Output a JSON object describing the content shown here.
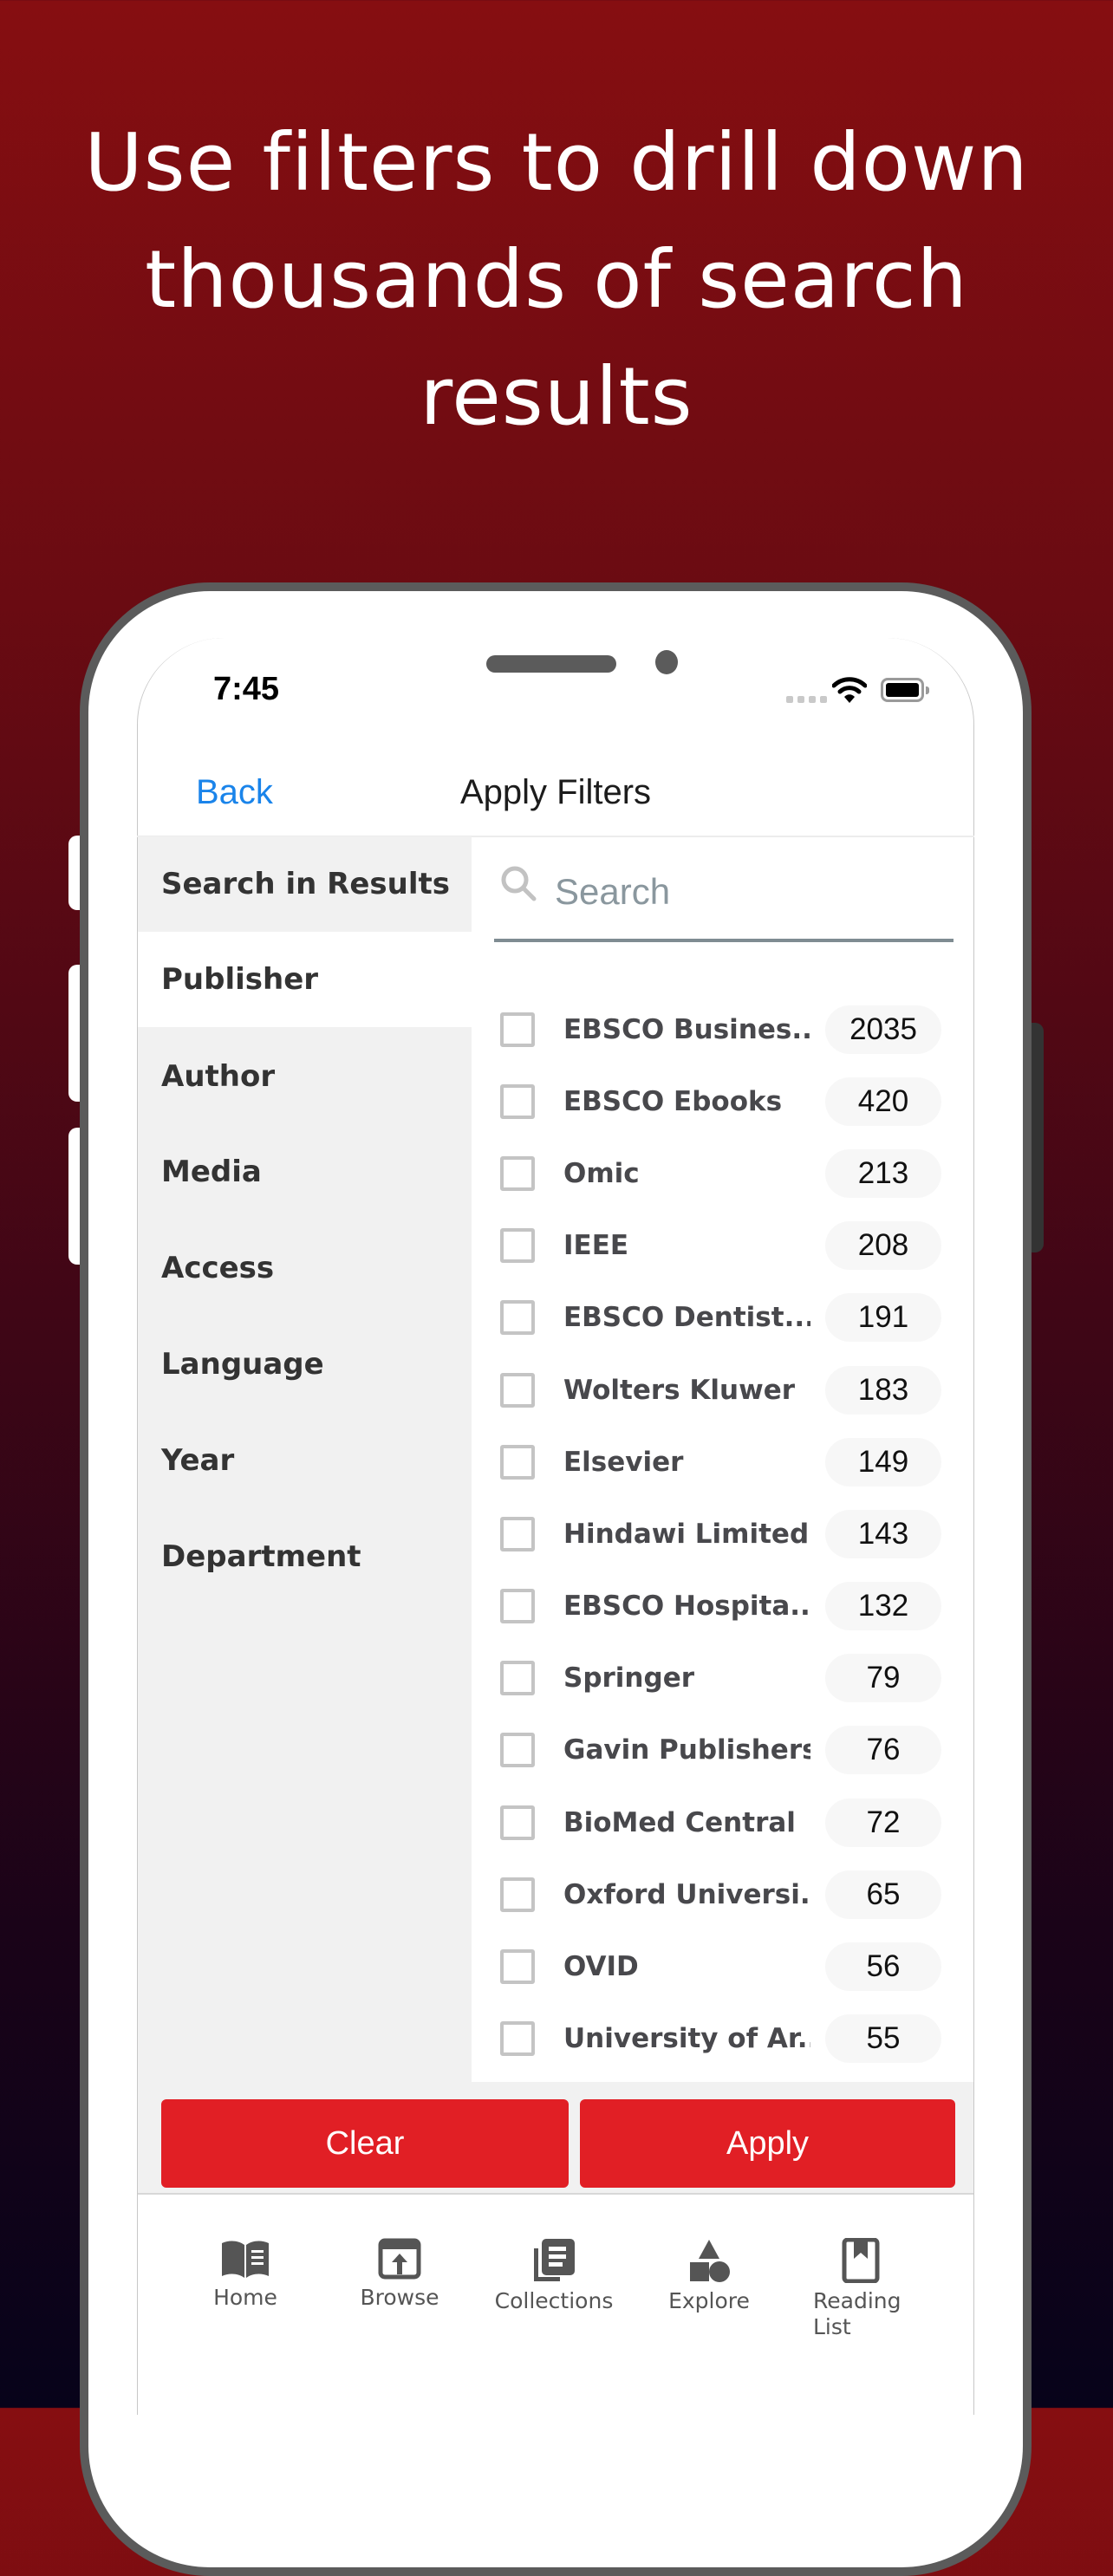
{
  "headline": {
    "line1": "Use filters to drill down",
    "line2": "thousands of search",
    "line3": "results"
  },
  "status_bar": {
    "time": "7:45",
    "wifi_icon": "wifi-icon",
    "battery_icon": "battery-icon"
  },
  "nav": {
    "back_label": "Back",
    "title": "Apply Filters"
  },
  "sidebar": {
    "items": [
      {
        "label": "Search in Results",
        "active": false
      },
      {
        "label": "Publisher",
        "active": true
      },
      {
        "label": "Author",
        "active": false
      },
      {
        "label": "Media",
        "active": false
      },
      {
        "label": "Access",
        "active": false
      },
      {
        "label": "Language",
        "active": false
      },
      {
        "label": "Year",
        "active": false
      },
      {
        "label": "Department",
        "active": false
      }
    ]
  },
  "search": {
    "placeholder": "Search",
    "value": ""
  },
  "publishers": [
    {
      "name": "EBSCO Busines...",
      "count": "2035",
      "checked": false
    },
    {
      "name": "EBSCO Ebooks",
      "count": "420",
      "checked": false
    },
    {
      "name": "Omic",
      "count": "213",
      "checked": false
    },
    {
      "name": "IEEE",
      "count": "208",
      "checked": false
    },
    {
      "name": "EBSCO Dentist...",
      "count": "191",
      "checked": false
    },
    {
      "name": "Wolters Kluwer",
      "count": "183",
      "checked": false
    },
    {
      "name": "Elsevier",
      "count": "149",
      "checked": false
    },
    {
      "name": "Hindawi Limited",
      "count": "143",
      "checked": false
    },
    {
      "name": "EBSCO Hospita...",
      "count": "132",
      "checked": false
    },
    {
      "name": "Springer",
      "count": "79",
      "checked": false
    },
    {
      "name": "Gavin Publishers",
      "count": "76",
      "checked": false
    },
    {
      "name": "BioMed Central",
      "count": "72",
      "checked": false
    },
    {
      "name": "Oxford Universi...",
      "count": "65",
      "checked": false
    },
    {
      "name": "OVID",
      "count": "56",
      "checked": false
    },
    {
      "name": "University of Ar...",
      "count": "55",
      "checked": false
    }
  ],
  "actions": {
    "clear_label": "Clear",
    "apply_label": "Apply"
  },
  "tabbar": {
    "items": [
      {
        "label": "Home",
        "icon": "open-book-icon"
      },
      {
        "label": "Browse",
        "icon": "browse-upload-icon"
      },
      {
        "label": "Collections",
        "icon": "collections-stack-icon"
      },
      {
        "label": "Explore",
        "icon": "shapes-icon"
      },
      {
        "label": "Reading List",
        "icon": "bookmark-book-icon"
      }
    ]
  },
  "colors": {
    "accent_red": "#e11f25",
    "link_blue": "#1a84ea",
    "bg_top": "#860e11",
    "bg_bottom": "#07031a"
  }
}
